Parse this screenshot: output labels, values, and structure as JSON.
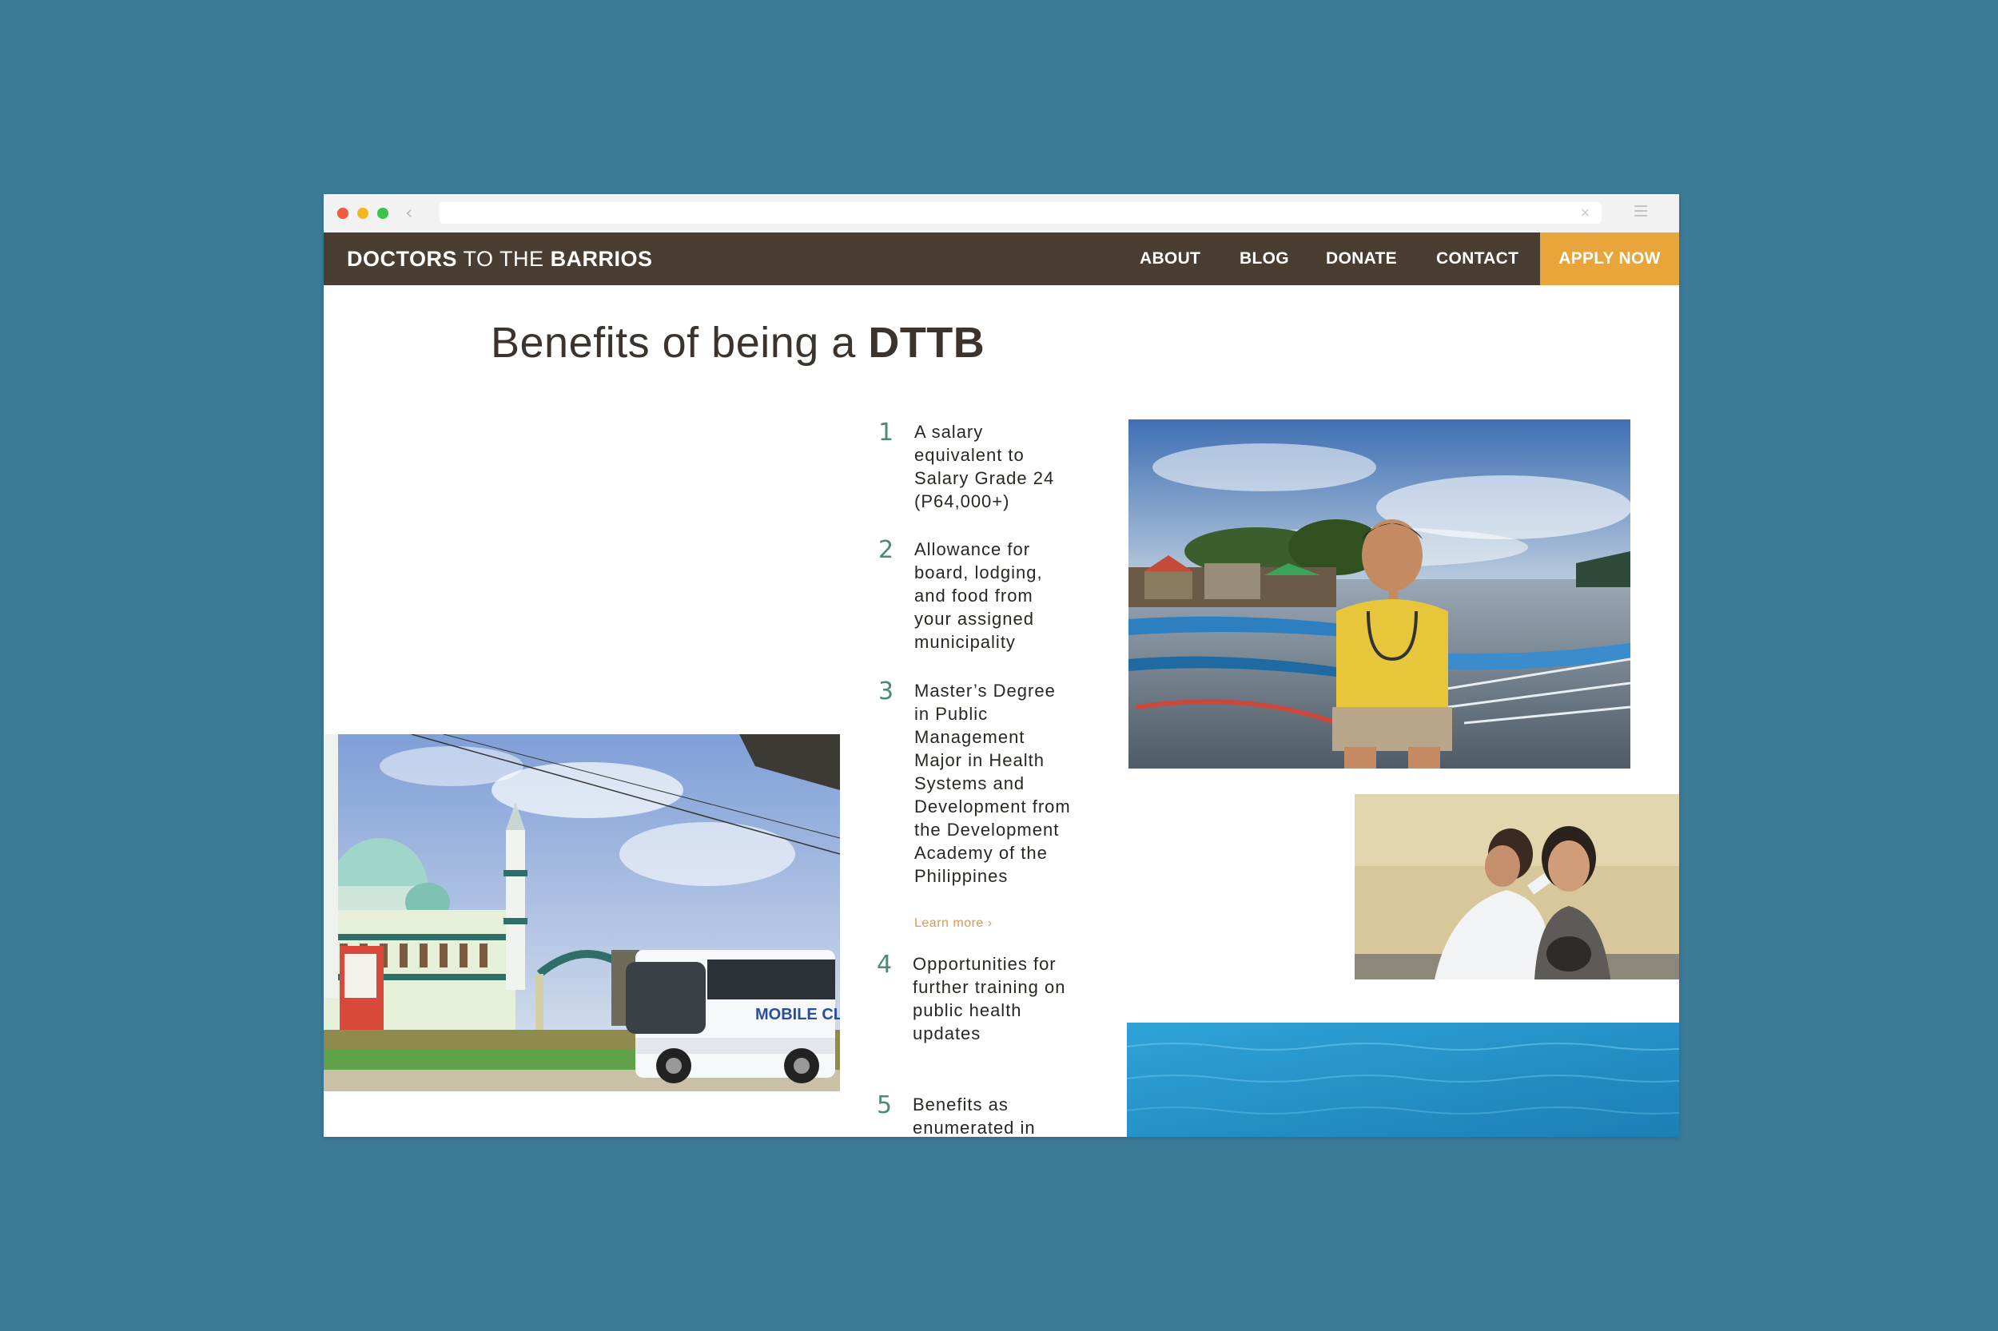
{
  "brand": {
    "part1": "DOCTORS",
    "part2": " TO THE ",
    "part3": "BARRIOS"
  },
  "nav": {
    "about": "ABOUT",
    "blog": "BLOG",
    "donate": "DONATE",
    "contact": "CONTACT",
    "apply": "APPLY NOW"
  },
  "heading": {
    "prefix": "Benefits of being a ",
    "bold": "DTTB"
  },
  "benefits": [
    {
      "num": "1",
      "text": "A salary equivalent to Salary Grade 24 (P64,000+)"
    },
    {
      "num": "2",
      "text": "Allowance for board, lodging, and food from your assigned municipality"
    },
    {
      "num": "3",
      "text": "Master’s Degree in Public Management Major in Health Systems and Development from the Development Academy of the Philippines"
    },
    {
      "num": "4",
      "text": "Opportunities for further training on public health updates"
    },
    {
      "num": "5",
      "text": "Benefits as enumerated in"
    }
  ],
  "learn_more": "Learn more ›",
  "colors": {
    "page_bg": "#3b7b98",
    "navbar": "#4a3e33",
    "accent": "#e7a53c",
    "number": "#4e8a6e"
  },
  "icons": {
    "back": "chevron-left-icon",
    "close": "close-icon",
    "menu": "hamburger-icon"
  },
  "photos": [
    "mosque-bus-photo",
    "doctor-boats-photo",
    "checkup-photo",
    "ocean-photo"
  ],
  "bus_sign": "MOBILE CLINIC"
}
